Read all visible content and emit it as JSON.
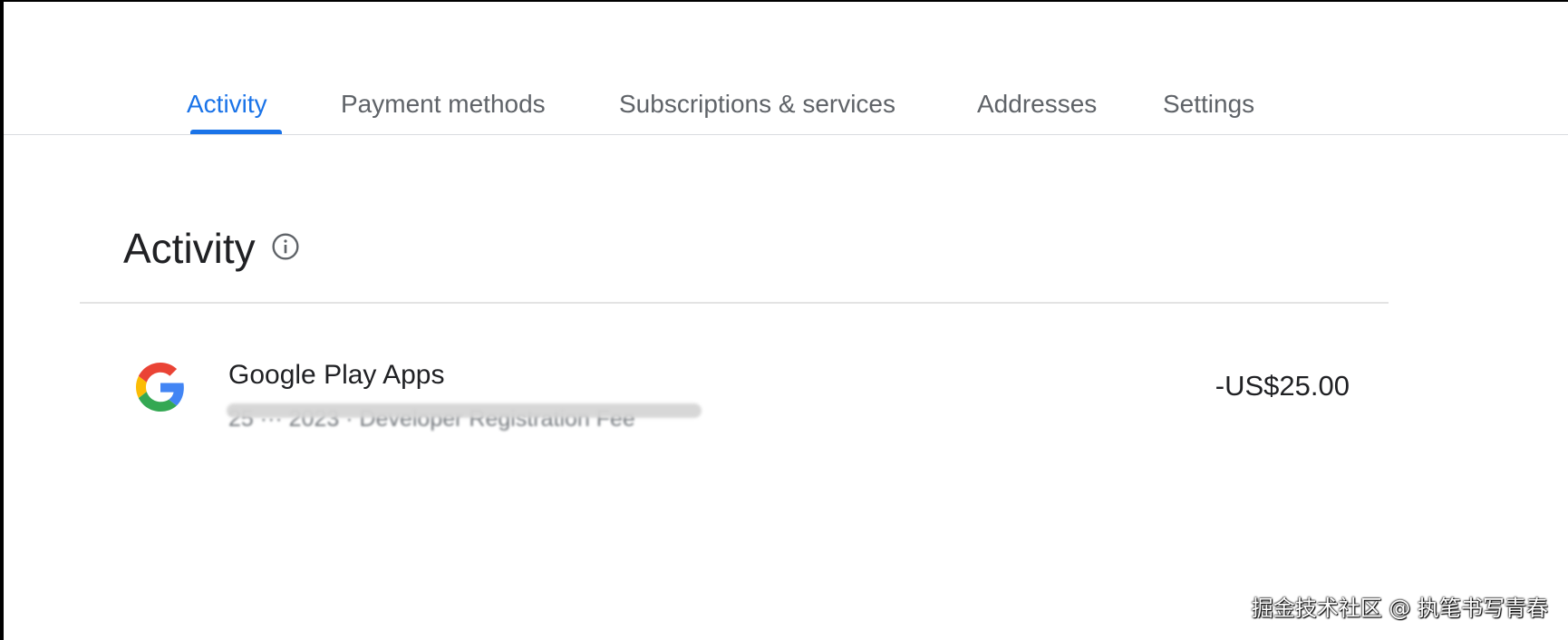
{
  "tabs": [
    {
      "label": "Activity",
      "active": true
    },
    {
      "label": "Payment methods",
      "active": false
    },
    {
      "label": "Subscriptions & services",
      "active": false
    },
    {
      "label": "Addresses",
      "active": false
    },
    {
      "label": "Settings",
      "active": false
    }
  ],
  "section": {
    "title": "Activity",
    "info_icon": "info-icon"
  },
  "activity": [
    {
      "icon": "google-g-logo",
      "title": "Google Play Apps",
      "subtitle": "25 ··· 2023 · Developer Registration Fee",
      "amount": "-US$25.00"
    }
  ],
  "watermark": "掘金技术社区 @ 执笔书写青春",
  "colors": {
    "accent": "#1a73e8",
    "text_primary": "#202124",
    "text_secondary": "#5f6368",
    "divider": "#dadce0"
  }
}
